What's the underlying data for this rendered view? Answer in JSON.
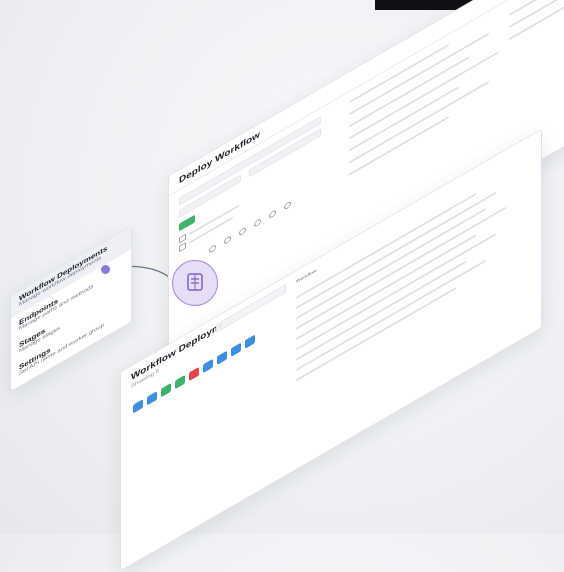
{
  "deploy_panel": {
    "title": "Deploy Workflow"
  },
  "sidebar": {
    "items": [
      {
        "title": "Workflow Deployments",
        "desc": "Manage workflow deployments"
      },
      {
        "title": "Endpoints",
        "desc": "Manage paths and methods"
      },
      {
        "title": "Stages",
        "desc": "Manage stages"
      },
      {
        "title": "Settings",
        "desc": "Set API name and worker group"
      }
    ]
  },
  "workflow_panel": {
    "title": "Workflow Deployments",
    "subtitle": "Showing 8",
    "workflow_header": "Workflow"
  },
  "status_badges": [
    "blue",
    "blue",
    "green",
    "green",
    "red",
    "blue",
    "blue",
    "blue",
    "blue"
  ],
  "colors": {
    "accent_purple": "#8f79d8",
    "hub_fill": "#e7ddf7",
    "green": "#43b36b",
    "blue": "#3d8fe0",
    "red": "#e0474a"
  },
  "icons": [
    "workflow-hub-icon",
    "search-icon"
  ]
}
